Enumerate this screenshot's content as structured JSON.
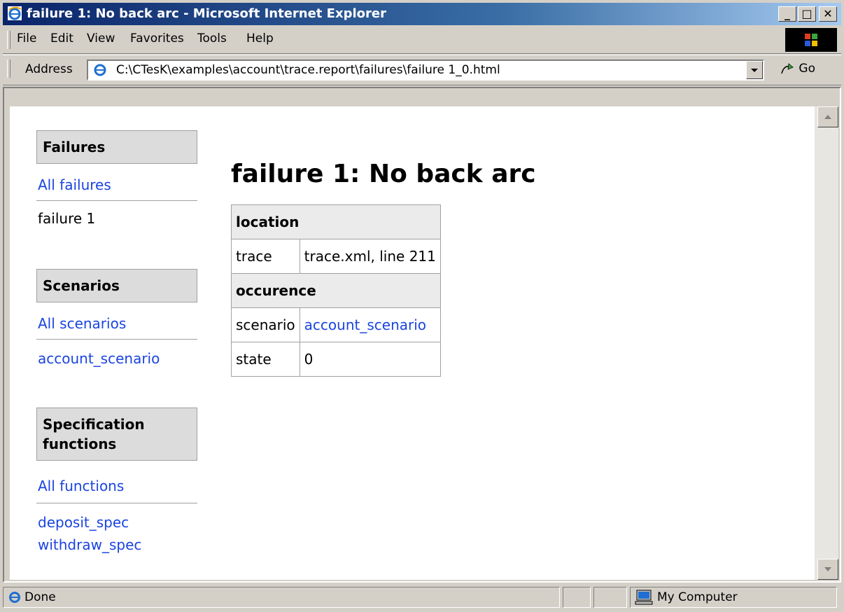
{
  "window": {
    "title": "failure 1: No back arc - Microsoft Internet Explorer",
    "minimize_label": "_",
    "maximize_label": "□",
    "close_label": "✕"
  },
  "menu": {
    "items": [
      {
        "label": "File"
      },
      {
        "label": "Edit"
      },
      {
        "label": "View"
      },
      {
        "label": "Favorites"
      },
      {
        "label": "Tools"
      },
      {
        "label": "Help"
      }
    ]
  },
  "address": {
    "label": "Address",
    "value": "C:\\CTesK\\examples\\account\\trace.report\\failures\\failure 1_0.html",
    "go_label": "Go"
  },
  "sidebar": {
    "failures": {
      "heading": "Failures",
      "all_link": "All failures",
      "items": [
        "failure 1"
      ]
    },
    "scenarios": {
      "heading": "Scenarios",
      "all_link": "All scenarios",
      "items": [
        "account_scenario"
      ]
    },
    "functions": {
      "heading_line1": "Specification",
      "heading_line2": "functions",
      "all_link": "All functions",
      "items": [
        "deposit_spec",
        "withdraw_spec"
      ]
    }
  },
  "main": {
    "title": "failure 1: No back arc",
    "table": {
      "location_header": "location",
      "trace_label": "trace",
      "trace_value": "trace.xml, line 211",
      "occurence_header": "occurence",
      "scenario_label": "scenario",
      "scenario_value": "account_scenario",
      "state_label": "state",
      "state_value": "0"
    }
  },
  "status": {
    "text": "Done",
    "zone": "My Computer"
  },
  "colors": {
    "link": "#1a44e0",
    "titlebar_start": "#0a246a",
    "titlebar_end": "#a6caf0",
    "chrome": "#d4d0c8"
  },
  "icons": [
    "ie-icon",
    "go-arrow-icon",
    "my-computer-icon",
    "windows-logo-icon",
    "scroll-up-icon",
    "scroll-down-icon",
    "dropdown-arrow-icon"
  ]
}
